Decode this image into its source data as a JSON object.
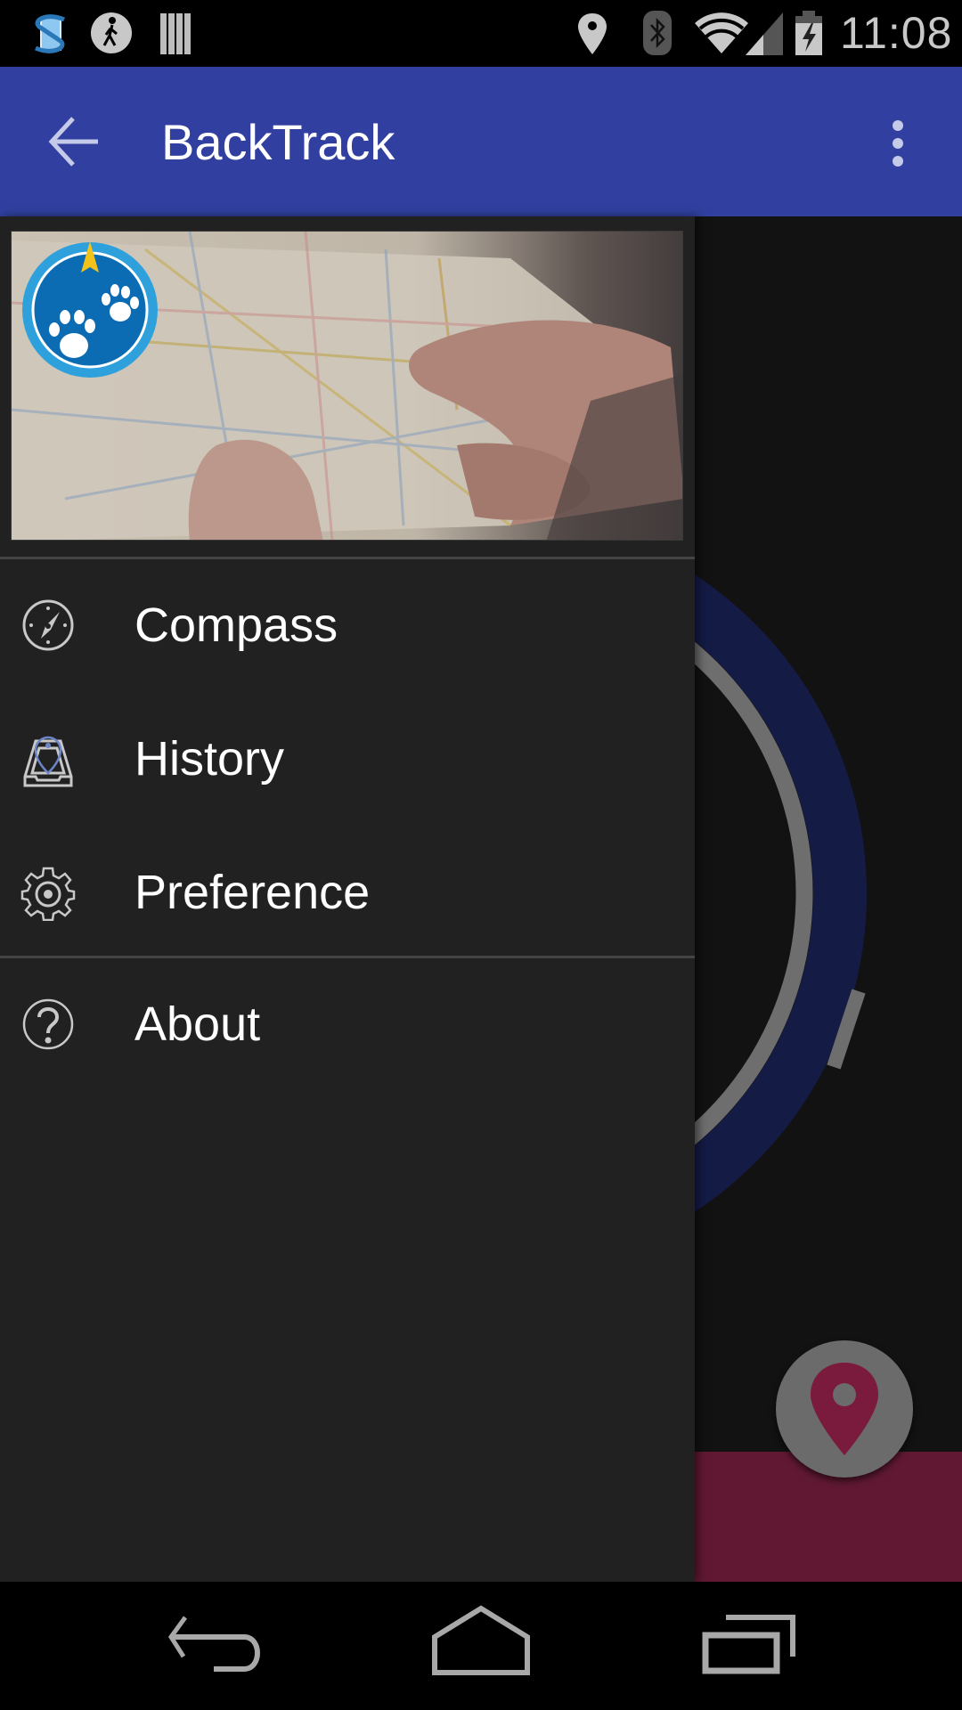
{
  "status_bar": {
    "time": "11:08",
    "left_icons": [
      "s-app-icon",
      "walking-icon",
      "barcode-icon"
    ],
    "right_icons": [
      "location-icon",
      "bluetooth-icon",
      "wifi-icon",
      "signal-icon",
      "battery-charging-icon"
    ]
  },
  "app_bar": {
    "title": "BackTrack",
    "back_icon": "arrow-left-icon",
    "menu_icon": "more-vert-icon",
    "color": "#3140a0"
  },
  "drawer": {
    "header_logo": "paw-compass-logo",
    "items": [
      {
        "label": "Compass",
        "icon": "compass-icon"
      },
      {
        "label": "History",
        "icon": "history-icon"
      },
      {
        "label": "Preference",
        "icon": "gear-icon"
      },
      {
        "label": "About",
        "icon": "help-icon"
      }
    ]
  },
  "main": {
    "fab_icon": "location-pin-icon",
    "ring_color": "#141b45",
    "accent_color": "#611933"
  },
  "nav_bar": {
    "buttons": [
      "back",
      "home",
      "recents"
    ]
  }
}
